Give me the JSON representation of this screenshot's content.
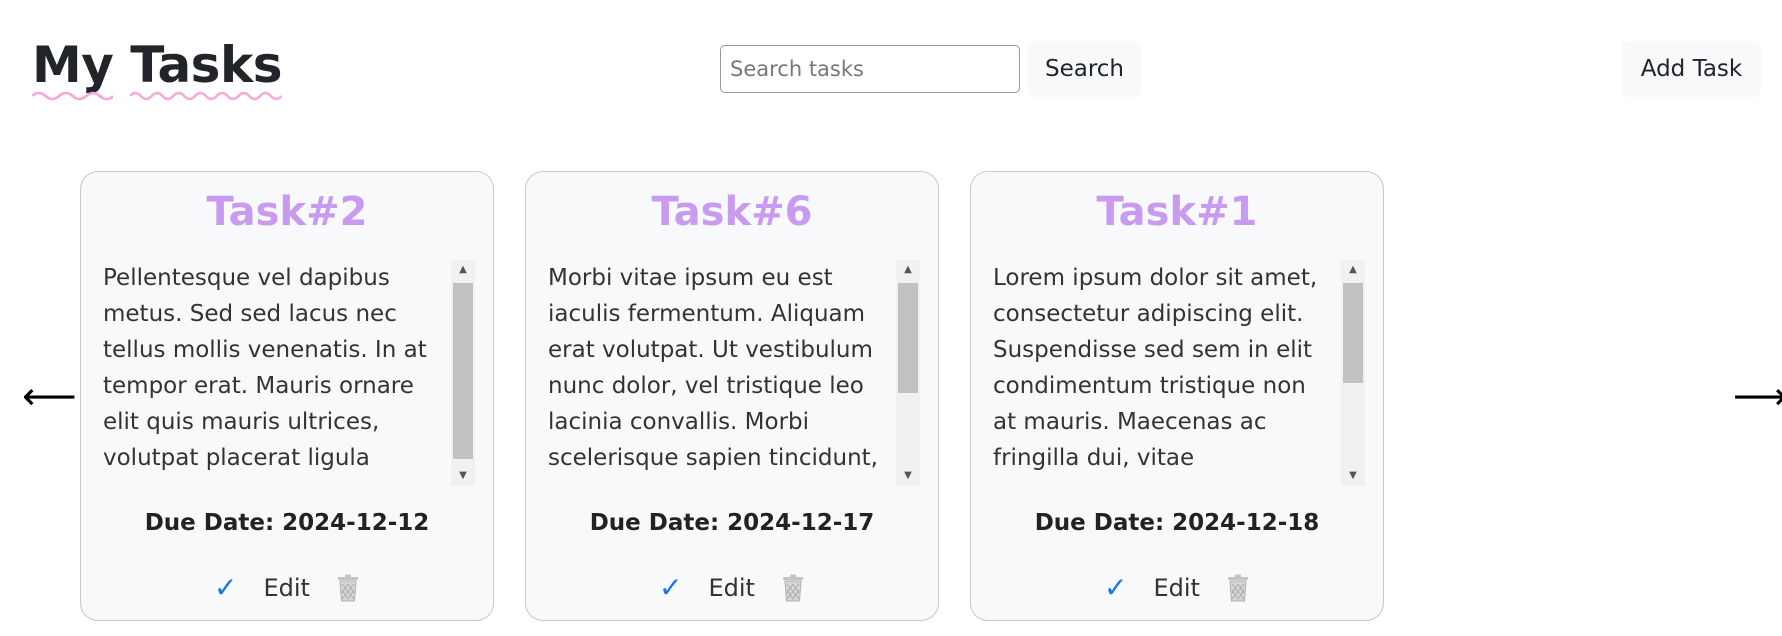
{
  "header": {
    "title": "My Tasks",
    "search_placeholder": "Search tasks",
    "search_label": "Search",
    "add_label": "Add Task"
  },
  "nav": {
    "prev_icon": "arrow-left-icon",
    "prev": "⟵",
    "next_icon": "arrow-right-icon",
    "next": "⟶"
  },
  "colors": {
    "task_title": "#c89bf0",
    "check": "#1a73e8",
    "underline": "#f5a9d9",
    "card_bg": "#f8f9fa"
  },
  "cards": [
    {
      "title": "Task#2",
      "description": "Pellentesque vel dapibus metus. Sed sed lacus nec tellus mollis venenatis. In at tempor erat. Mauris ornare elit quis mauris ultrices, volutpat placerat ligula viverra.",
      "due": "Due Date: 2024-12-12",
      "complete_icon": "check-icon",
      "complete": "✓",
      "edit": "Edit",
      "delete_icon": "trash-icon"
    },
    {
      "title": "Task#6",
      "description": "Morbi vitae ipsum eu est iaculis fermentum. Aliquam erat volutpat. Ut vestibulum nunc dolor, vel tristique leo lacinia convallis. Morbi scelerisque sapien tincidunt,",
      "due": "Due Date: 2024-12-17",
      "complete_icon": "check-icon",
      "complete": "✓",
      "edit": "Edit",
      "delete_icon": "trash-icon"
    },
    {
      "title": "Task#1",
      "description": "Lorem ipsum dolor sit amet, consectetur adipiscing elit. Suspendisse sed sem in elit condimentum tristique non at mauris. Maecenas ac fringilla dui, vitae consectetur mi. In",
      "due": "Due Date: 2024-12-18",
      "complete_icon": "check-icon",
      "complete": "✓",
      "edit": "Edit",
      "delete_icon": "trash-icon"
    }
  ]
}
